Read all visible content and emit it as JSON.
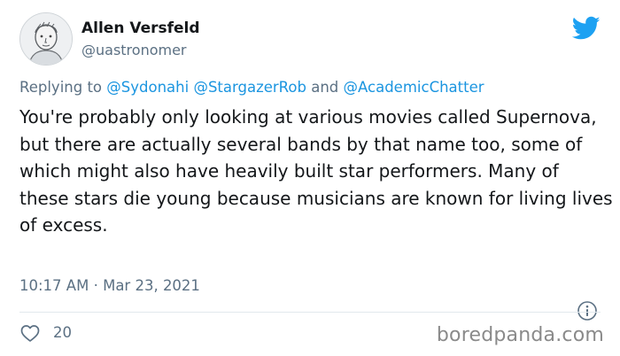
{
  "author": {
    "name": "Allen Versfeld",
    "handle": "@uastronomer"
  },
  "reply": {
    "prefix": "Replying to ",
    "mention1": "@Sydonahi",
    "mention2": "@StargazerRob",
    "conjunction": "and",
    "mention3": "@AcademicChatter"
  },
  "tweet": {
    "text": "You're probably only looking at various movies called Supernova, but there are actually several bands by that name too, some of which might also have heavily built star performers. Many of these stars die young because musicians are known for living lives of excess.",
    "time": "10:17 AM",
    "separator": "·",
    "date": "Mar 23, 2021"
  },
  "stats": {
    "likes": "20"
  },
  "watermark": "boredpanda.com",
  "colors": {
    "brand": "#1da1f2",
    "mention": "#1b95e0",
    "muted": "#5b7083"
  },
  "icons": {
    "logo": "twitter-bird-icon",
    "info": "info-icon",
    "like": "heart-icon"
  }
}
